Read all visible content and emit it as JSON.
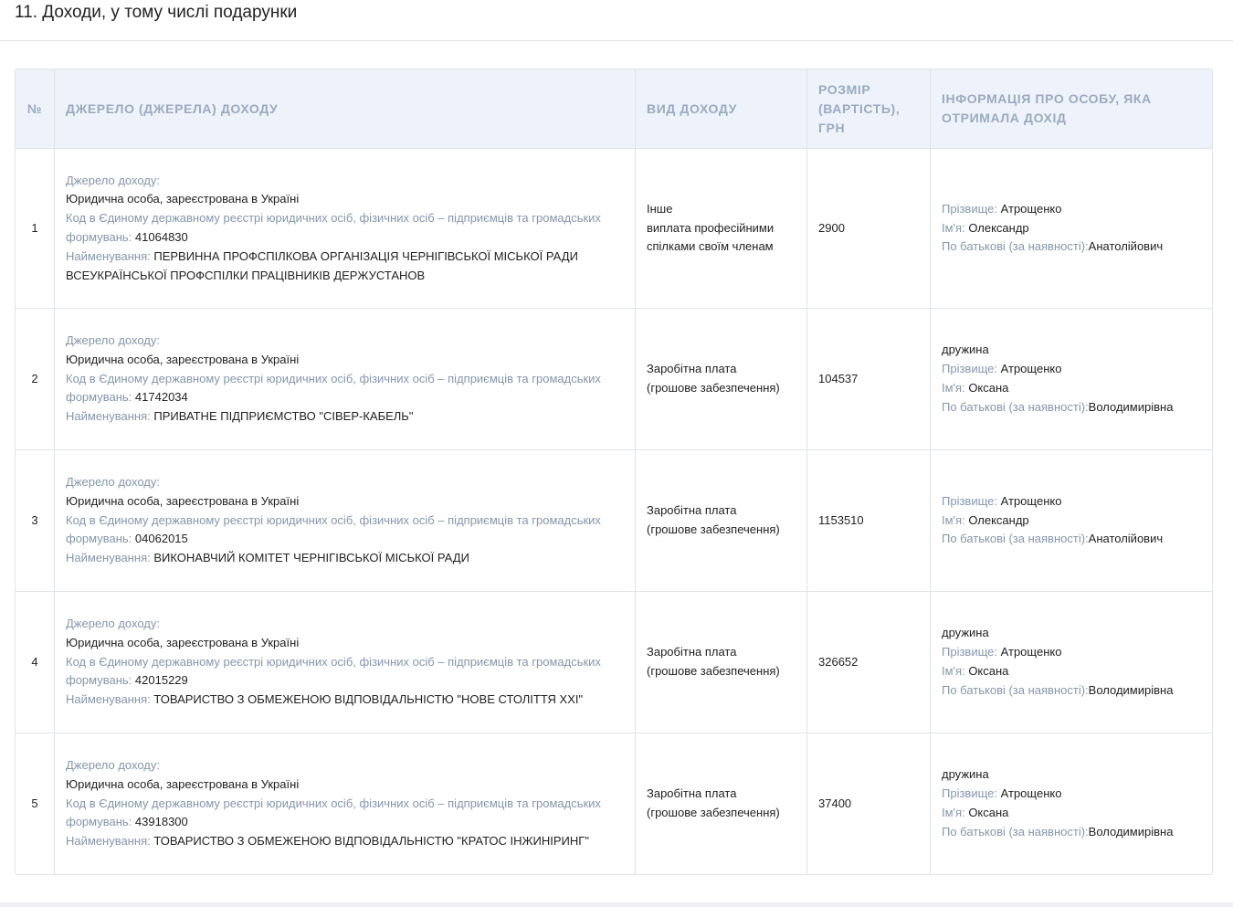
{
  "section": {
    "title": "11. Доходи, у тому числі подарунки"
  },
  "columns": {
    "num": "№",
    "source": "ДЖЕРЕЛО (ДЖЕРЕЛА) ДОХОДУ",
    "type": "ВИД ДОХОДУ",
    "amount": "РОЗМІР (ВАРТІСТЬ), ГРН",
    "person": "ІНФОРМАЦІЯ ПРО ОСОБУ, ЯКА ОТРИМАЛА ДОХІД"
  },
  "labels": {
    "source_heading": "Джерело доходу:",
    "code": "Код в Єдиному державному реєстрі юридичних осіб, фізичних осіб – підприємців та громадських формувань:",
    "name": "Найменування:",
    "surname": "Прізвище:",
    "first_name": "Ім'я:",
    "patronymic": "По батькові (за наявності):"
  },
  "rows": [
    {
      "num": "1",
      "entity_type": "Юридична особа, зареєстрована в Україні",
      "code": "41064830",
      "name": "ПЕРВИННА ПРОФСПІЛКОВА ОРГАНІЗАЦІЯ ЧЕРНІГІВСЬКОЇ МІСЬКОЇ РАДИ ВСЕУКРАЇНСЬКОЇ ПРОФСПІЛКИ ПРАЦІВНИКІВ ДЕРЖУСТАНОВ",
      "income_type_1": "Інше",
      "income_type_2": "виплата професійними спілками своїм членам",
      "amount": "2900",
      "relation": "",
      "surname": "Атрощенко",
      "first_name": "Олександр",
      "patronymic": "Анатолійович"
    },
    {
      "num": "2",
      "entity_type": "Юридична особа, зареєстрована в Україні",
      "code": "41742034",
      "name": "ПРИВАТНЕ ПІДПРИЄМСТВО \"СІВЕР-КАБЕЛЬ\"",
      "income_type_1": "Заробітна плата",
      "income_type_2": "(грошове забезпечення)",
      "amount": "104537",
      "relation": "дружина",
      "surname": "Атрощенко",
      "first_name": "Оксана",
      "patronymic": "Володимирівна"
    },
    {
      "num": "3",
      "entity_type": "Юридична особа, зареєстрована в Україні",
      "code": "04062015",
      "name": "ВИКОНАВЧИЙ КОМІТЕТ ЧЕРНІГІВСЬКОЇ МІСЬКОЇ РАДИ",
      "income_type_1": "Заробітна плата",
      "income_type_2": "(грошове забезпечення)",
      "amount": "1153510",
      "relation": "",
      "surname": "Атрощенко",
      "first_name": "Олександр",
      "patronymic": "Анатолійович"
    },
    {
      "num": "4",
      "entity_type": "Юридична особа, зареєстрована в Україні",
      "code": "42015229",
      "name": "ТОВАРИСТВО З ОБМЕЖЕНОЮ ВІДПОВІДАЛЬНІСТЮ \"НОВЕ СТОЛІТТЯ ХХІ\"",
      "income_type_1": "Заробітна плата",
      "income_type_2": "(грошове забезпечення)",
      "amount": "326652",
      "relation": "дружина",
      "surname": "Атрощенко",
      "first_name": "Оксана",
      "patronymic": "Володимирівна"
    },
    {
      "num": "5",
      "entity_type": "Юридична особа, зареєстрована в Україні",
      "code": "43918300",
      "name": "ТОВАРИСТВО З ОБМЕЖЕНОЮ ВІДПОВІДАЛЬНІСТЮ \"КРАТОС ІНЖИНІРИНГ\"",
      "income_type_1": "Заробітна плата",
      "income_type_2": "(грошове забезпечення)",
      "amount": "37400",
      "relation": "дружина",
      "surname": "Атрощенко",
      "first_name": "Оксана",
      "patronymic": "Володимирівна"
    }
  ]
}
